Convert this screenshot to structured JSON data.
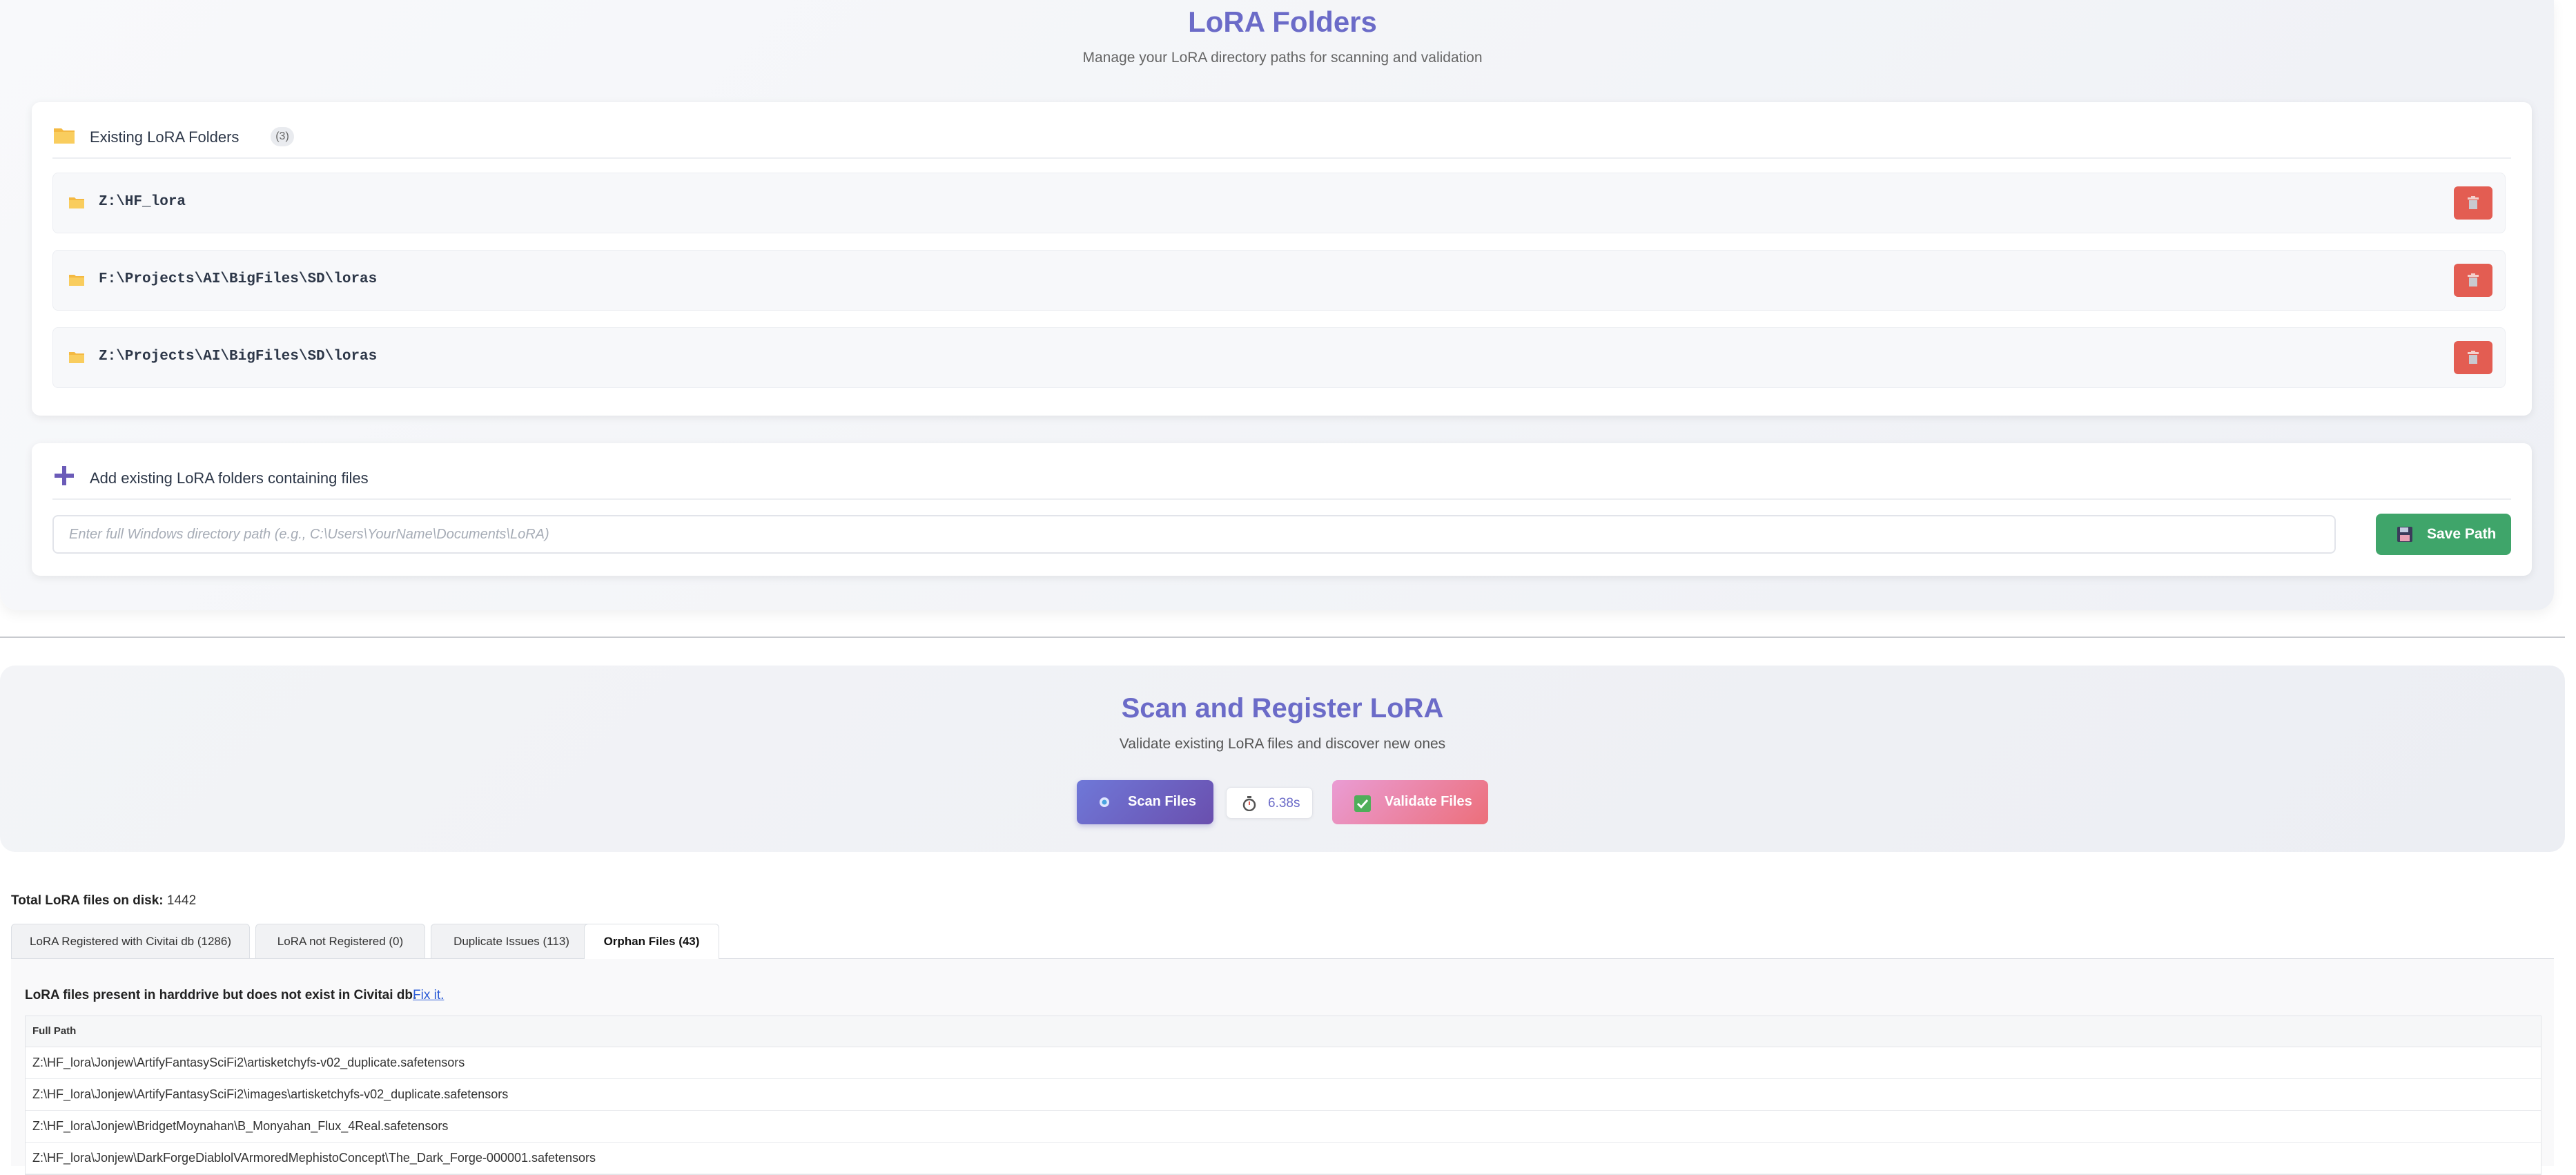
{
  "header": {
    "title": "LoRA Folders",
    "subtitle": "Manage your LoRA directory paths for scanning and validation"
  },
  "existing": {
    "title": "Existing LoRA Folders",
    "count": "(3)",
    "folders": [
      {
        "path": "Z:\\HF_lora"
      },
      {
        "path": "F:\\Projects\\AI\\BigFiles\\SD\\loras"
      },
      {
        "path": "Z:\\Projects\\AI\\BigFiles\\SD\\loras"
      }
    ]
  },
  "add_folder": {
    "title": "Add existing LoRA folders containing files",
    "placeholder": "Enter full Windows directory path (e.g., C:\\Users\\YourName\\Documents\\LoRA)",
    "value": "",
    "save_label": "Save Path"
  },
  "scan": {
    "title": "Scan and Register LoRA",
    "subtitle": "Validate existing LoRA files and discover new ones",
    "scan_label": "Scan Files",
    "time": "6.38s",
    "validate_label": "Validate Files"
  },
  "results": {
    "total_label": "Total LoRA files on disk:",
    "total_value": "1442",
    "tabs": [
      {
        "label": "LoRA Registered with Civitai db (1286)"
      },
      {
        "label": "LoRA not Registered (0)"
      },
      {
        "label": "Duplicate Issues (113)"
      },
      {
        "label": "Orphan Files (43)"
      }
    ],
    "active_tab": "Orphan Files (43)",
    "orphan_message": "LoRA files present in harddrive but does not exist in Civitai db.",
    "fix_label": "Fix it.",
    "table_header": "Full Path",
    "rows": [
      "Z:\\HF_lora\\Jonjew\\ArtifyFantasySciFi2\\artisketchyfs-v02_duplicate.safetensors",
      "Z:\\HF_lora\\Jonjew\\ArtifyFantasySciFi2\\images\\artisketchyfs-v02_duplicate.safetensors",
      "Z:\\HF_lora\\Jonjew\\BridgetMoynahan\\B_Monyahan_Flux_4Real.safetensors",
      "Z:\\HF_lora\\Jonjew\\DarkForgeDiablolVArmoredMephistoConcept\\The_Dark_Forge-000001.safetensors"
    ]
  },
  "colors": {
    "accent": "#6b6bc8",
    "danger": "#e35d52",
    "success": "#3fa56a",
    "link": "#2c5cd6"
  }
}
